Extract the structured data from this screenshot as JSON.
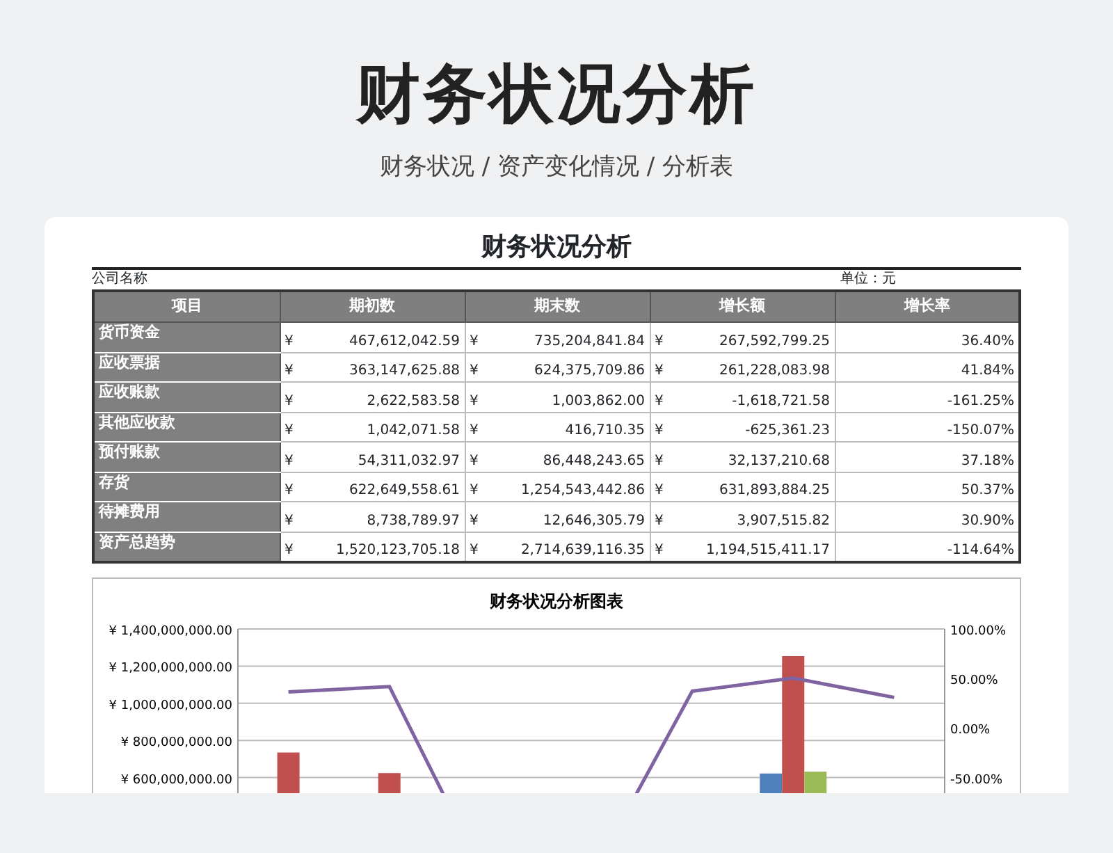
{
  "header": {
    "title": "财务状况分析",
    "subtitle": "财务状况 / 资产变化情况 / 分析表"
  },
  "sheet": {
    "title": "财务状况分析",
    "company_label": "公司名称",
    "unit_label": "单位：元",
    "columns": [
      "项目",
      "期初数",
      "期末数",
      "增长额",
      "增长率"
    ],
    "rows": [
      {
        "item": "货币资金",
        "begin": "467,612,042.59",
        "end": "735,204,841.84",
        "growth": "267,592,799.25",
        "rate": "36.40%"
      },
      {
        "item": "应收票据",
        "begin": "363,147,625.88",
        "end": "624,375,709.86",
        "growth": "261,228,083.98",
        "rate": "41.84%"
      },
      {
        "item": "应收账款",
        "begin": "2,622,583.58",
        "end": "1,003,862.00",
        "growth": "-1,618,721.58",
        "rate": "-161.25%"
      },
      {
        "item": "其他应收款",
        "begin": "1,042,071.58",
        "end": "416,710.35",
        "growth": "-625,361.23",
        "rate": "-150.07%"
      },
      {
        "item": "预付账款",
        "begin": "54,311,032.97",
        "end": "86,448,243.65",
        "growth": "32,137,210.68",
        "rate": "37.18%"
      },
      {
        "item": "存货",
        "begin": "622,649,558.61",
        "end": "1,254,543,442.86",
        "growth": "631,893,884.25",
        "rate": "50.37%"
      },
      {
        "item": "待摊费用",
        "begin": "8,738,789.97",
        "end": "12,646,305.79",
        "growth": "3,907,515.82",
        "rate": "30.90%"
      },
      {
        "item": "资产总趋势",
        "begin": "1,520,123,705.18",
        "end": "2,714,639,116.35",
        "growth": "1,194,515,411.17",
        "rate": "-114.64%"
      }
    ],
    "currency": "¥"
  },
  "chart": {
    "title": "财务状况分析图表",
    "left_axis_labels": [
      "¥ 1,400,000,000.00",
      "¥ 1,200,000,000.00",
      "¥ 1,000,000,000.00",
      "¥ 800,000,000.00",
      "¥ 600,000,000.00"
    ],
    "right_axis_labels": [
      "100.00%",
      "50.00%",
      "0.00%",
      "-50.00%"
    ]
  }
}
